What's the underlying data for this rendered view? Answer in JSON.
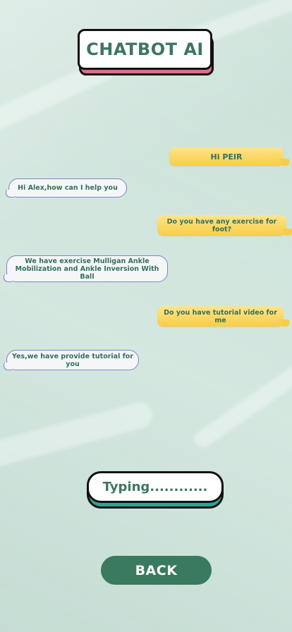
{
  "header": {
    "title": "CHATBOT AI"
  },
  "messages": [
    {
      "sender": "user",
      "text": "Hi PEIR"
    },
    {
      "sender": "bot",
      "text": "Hi Alex,how can I help you"
    },
    {
      "sender": "user",
      "text": "Do you have any exercise for foot?"
    },
    {
      "sender": "bot",
      "text": "We have exercise Mulligan Ankle Mobilization and Ankle Inversion With Ball"
    },
    {
      "sender": "user",
      "text": "Do you have tutorial video for me"
    },
    {
      "sender": "bot",
      "text": "Yes,we have provide tutorial for you"
    }
  ],
  "typing": {
    "label": "Typing............"
  },
  "footer": {
    "back_label": "BACK"
  },
  "colors": {
    "accent_green": "#3a7a5f",
    "user_bubble": "#f8cd47",
    "title_shadow": "#d7708e",
    "typing_shadow": "#2aa695"
  }
}
